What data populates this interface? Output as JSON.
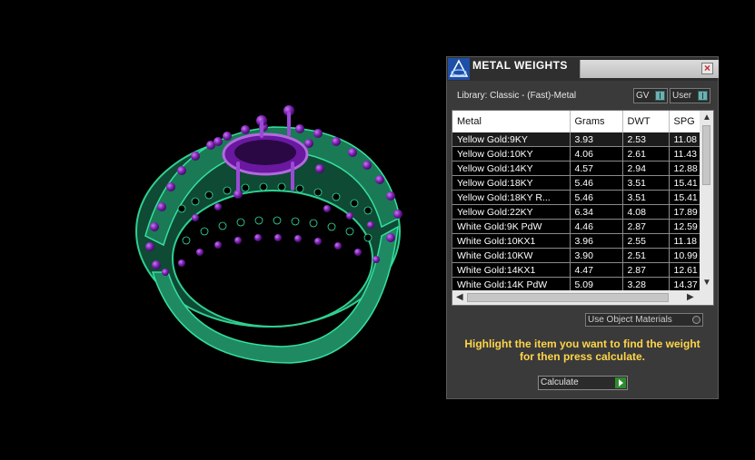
{
  "panel": {
    "title": "METAL WEIGHTS",
    "close_icon": "close-icon",
    "library_label": "Library: Classic - (Fast)-Metal",
    "toggles": [
      {
        "label": "GV"
      },
      {
        "label": "User"
      }
    ],
    "table": {
      "columns": [
        "Metal",
        "Grams",
        "DWT",
        "SPG"
      ],
      "rows": [
        [
          "Yellow Gold:9KY",
          "3.93",
          "2.53",
          "11.08"
        ],
        [
          "Yellow Gold:10KY",
          "4.06",
          "2.61",
          "11.43"
        ],
        [
          "Yellow Gold:14KY",
          "4.57",
          "2.94",
          "12.88"
        ],
        [
          "Yellow Gold:18KY",
          "5.46",
          "3.51",
          "15.41"
        ],
        [
          "Yellow Gold:18KY R...",
          "5.46",
          "3.51",
          "15.41"
        ],
        [
          "Yellow Gold:22KY",
          "6.34",
          "4.08",
          "17.89"
        ],
        [
          "White Gold:9K PdW",
          "4.46",
          "2.87",
          "12.59"
        ],
        [
          "White Gold:10KX1",
          "3.96",
          "2.55",
          "11.18"
        ],
        [
          "White Gold:10KW",
          "3.90",
          "2.51",
          "10.99"
        ],
        [
          "White Gold:14KX1",
          "4.47",
          "2.87",
          "12.61"
        ],
        [
          "White Gold:14K PdW",
          "5.09",
          "3.28",
          "14.37"
        ]
      ]
    },
    "use_object_materials": "Use Object Materials",
    "hint_line1": "Highlight the item you want to find the weight",
    "hint_line2": "for then press calculate.",
    "calculate_label": "Calculate"
  },
  "colors": {
    "ring_band": "#1f8a62",
    "gems": "#7a1fb0",
    "hint_text": "#ffd54a",
    "panel_bg": "#3a3a3a"
  }
}
